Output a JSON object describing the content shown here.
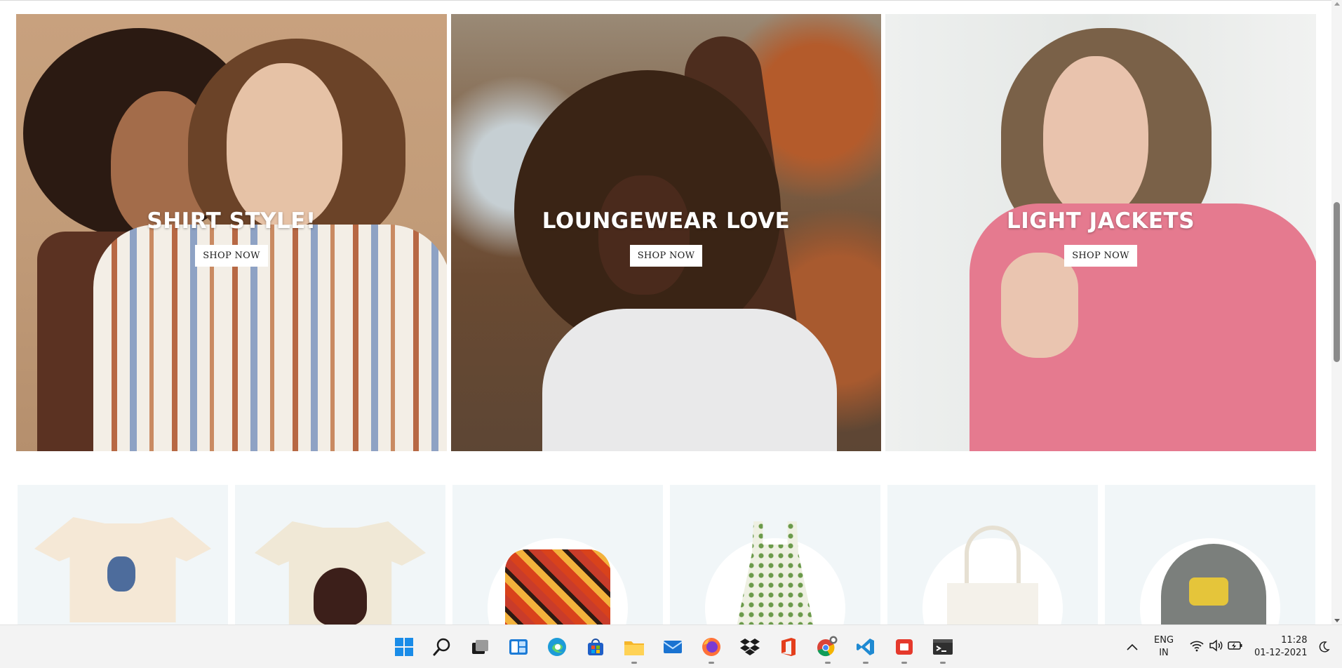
{
  "banners": [
    {
      "title": "SHIRT STYLE!",
      "button": "SHOP NOW"
    },
    {
      "title": "LOUNGEWEAR LOVE",
      "button": "SHOP NOW"
    },
    {
      "title": "LIGHT JACKETS",
      "button": "SHOP NOW"
    }
  ],
  "taskbar": {
    "icons": [
      "windows-start-icon",
      "search-icon",
      "task-view-icon",
      "widgets-icon",
      "edge-icon",
      "store-icon",
      "file-explorer-icon",
      "mail-icon",
      "firefox-icon",
      "dropbox-icon",
      "office-icon",
      "chrome-icon",
      "vscode-icon",
      "screen-recorder-icon",
      "terminal-icon"
    ],
    "tray": {
      "lang_top": "ENG",
      "lang_bottom": "IN",
      "time": "11:28",
      "date": "01-12-2021"
    }
  },
  "colors": {
    "accent": "#f15b3d",
    "product_bg": "#f1f6f8"
  }
}
